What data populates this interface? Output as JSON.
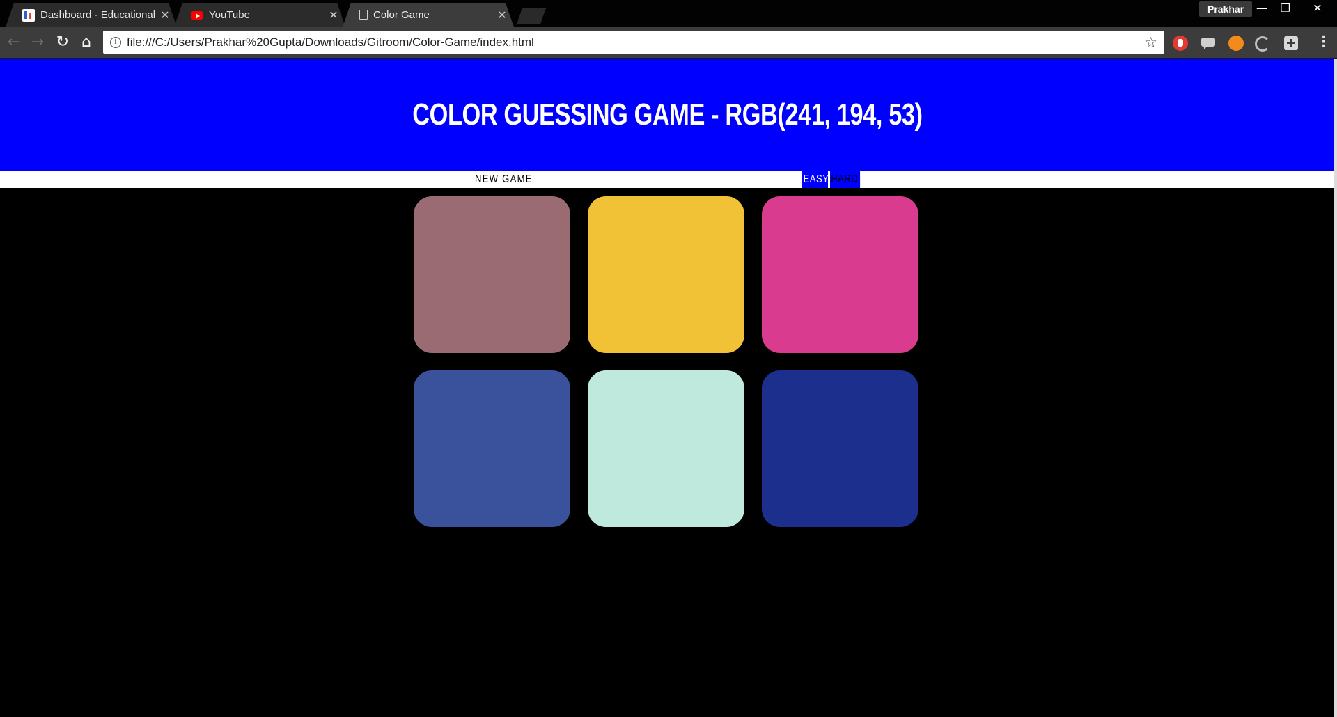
{
  "browser": {
    "tabs": [
      {
        "title": "Dashboard - Educational",
        "favicon": "dashboard-icon",
        "active": false
      },
      {
        "title": "YouTube",
        "favicon": "youtube-icon",
        "active": false
      },
      {
        "title": "Color Game",
        "favicon": "document-icon",
        "active": true
      }
    ],
    "profile_name": "Prakhar",
    "url": "file:///C:/Users/Prakhar%20Gupta/Downloads/Gitroom/Color-Game/index.html",
    "window_controls": {
      "minimize": "—",
      "restore": "❐",
      "close": "✕"
    }
  },
  "game": {
    "title": "COLOR GUESSING GAME - RGB(241, 194, 53)",
    "header_color": "#0000ff",
    "new_game_label": "NEW GAME",
    "easy_label": "EASY",
    "hard_label": "HARD",
    "squares": [
      {
        "color": "#9a6b72"
      },
      {
        "color": "#f1c235"
      },
      {
        "color": "#d93b8e"
      },
      {
        "color": "#3a519b"
      },
      {
        "color": "#bee9dc"
      },
      {
        "color": "#1c2f8c"
      }
    ]
  }
}
